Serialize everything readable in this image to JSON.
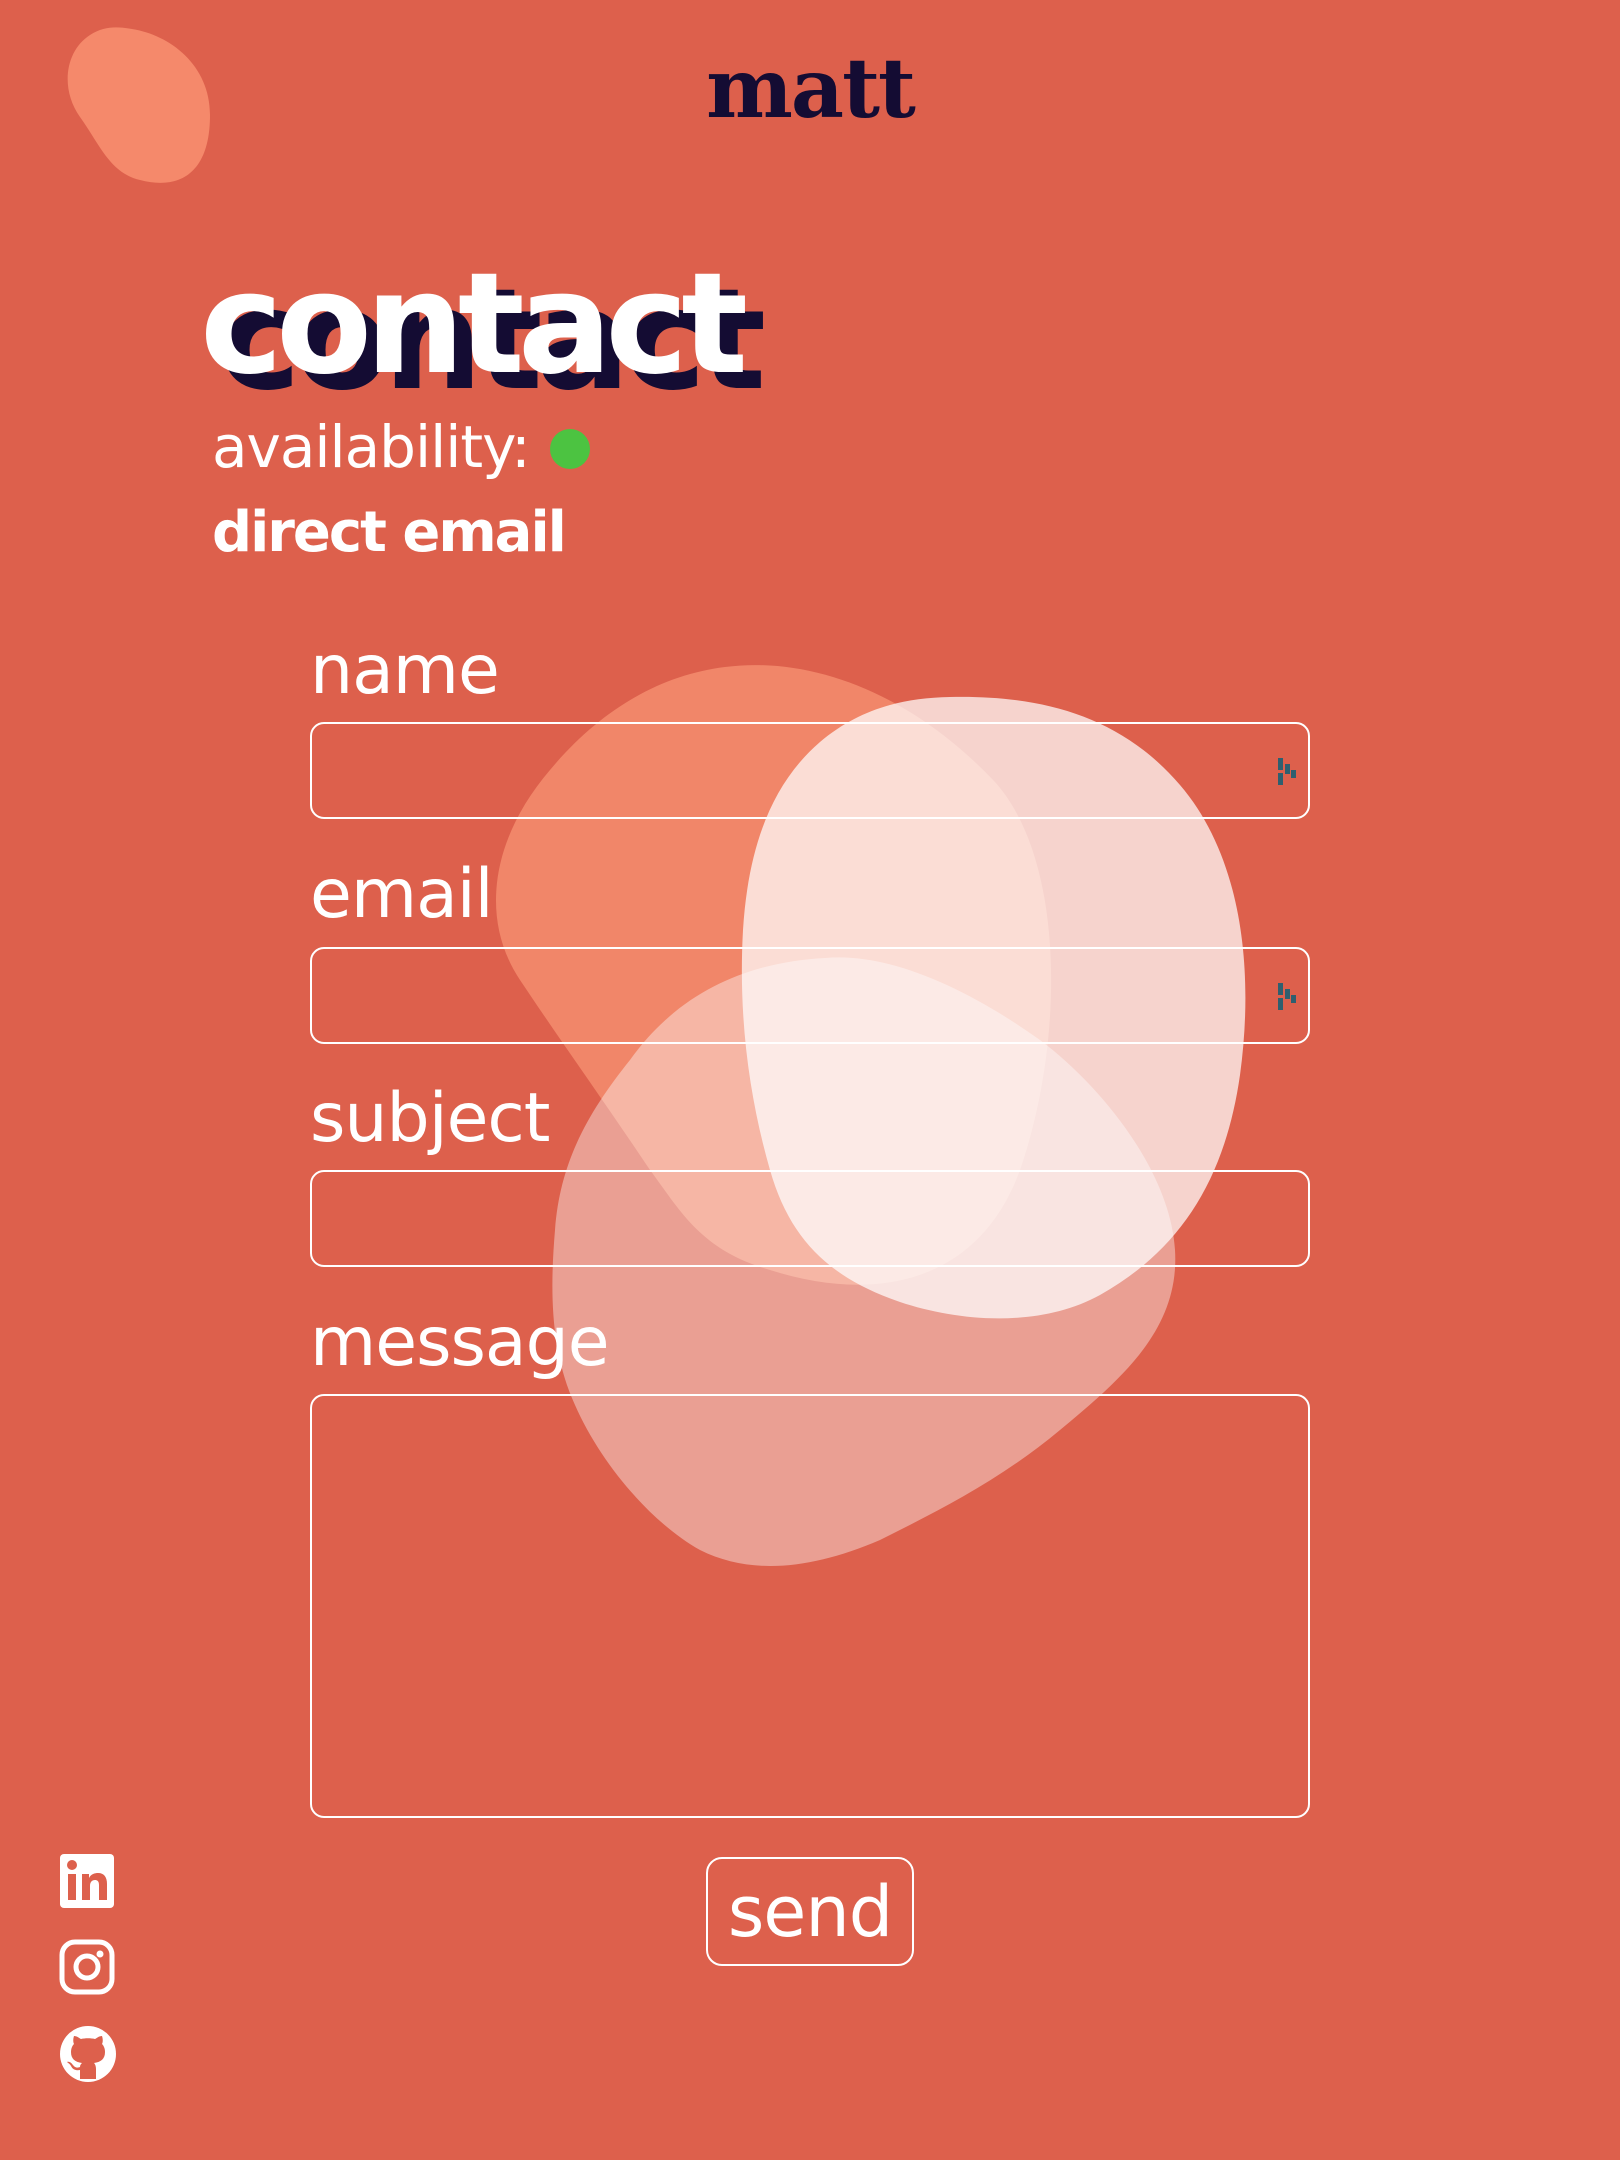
{
  "header": {
    "logo": "matt"
  },
  "page": {
    "title": "contact",
    "availability_label": "availability:",
    "direct_email_label": "direct email"
  },
  "form": {
    "fields": [
      {
        "label": "name",
        "value": ""
      },
      {
        "label": "email",
        "value": ""
      },
      {
        "label": "subject",
        "value": ""
      },
      {
        "label": "message",
        "value": ""
      }
    ],
    "send_label": "send"
  },
  "social": [
    "linkedin-icon",
    "instagram-icon",
    "github-icon"
  ],
  "colors": {
    "background": "#dd604c",
    "text": "#ffffff",
    "dark": "#140c33",
    "status_available": "#4cc341",
    "blob_corner": "#f5896b"
  }
}
